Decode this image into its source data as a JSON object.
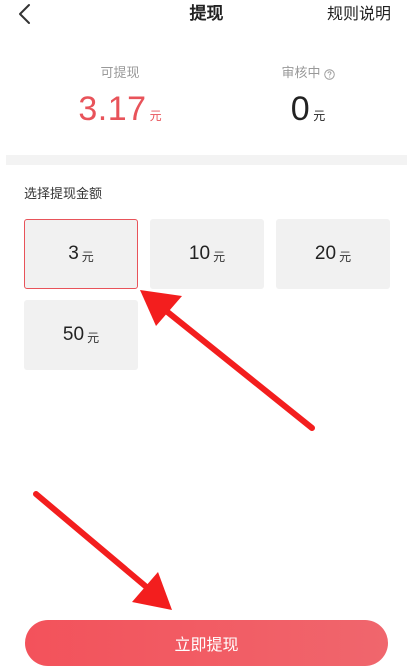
{
  "header": {
    "title": "提现",
    "rules_link": "规则说明",
    "back_icon": "chevron-left-icon"
  },
  "summary": {
    "withdrawable": {
      "label": "可提现",
      "value": "3.17",
      "unit": "元",
      "color": "#e8535a"
    },
    "reviewing": {
      "label": "审核中",
      "value": "0",
      "unit": "元",
      "icon": "help-circle-icon"
    }
  },
  "amount_section": {
    "label": "选择提现金额",
    "options": [
      {
        "value": "3",
        "unit": "元",
        "selected": true
      },
      {
        "value": "10",
        "unit": "元",
        "selected": false
      },
      {
        "value": "20",
        "unit": "元",
        "selected": false
      },
      {
        "value": "50",
        "unit": "元",
        "selected": false
      }
    ]
  },
  "withdraw_button": {
    "label": "立即提现",
    "color": "#f0575f"
  },
  "annotation": {
    "arrow_color": "#f31e1e"
  }
}
